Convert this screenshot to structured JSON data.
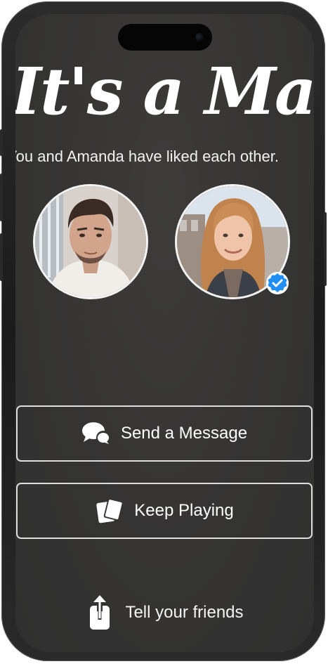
{
  "match": {
    "title": "It's a Match!",
    "subtitle": "You and Amanda have liked each other."
  },
  "avatars": {
    "user": {
      "name": "",
      "verified": false
    },
    "match": {
      "name": "Amanda",
      "verified": true
    }
  },
  "actions": {
    "send_message_label": "Send a Message",
    "keep_playing_label": "Keep Playing",
    "tell_friends_label": "Tell your friends"
  },
  "icons": {
    "send_message": "chat-bubbles-icon",
    "keep_playing": "cards-icon",
    "tell_friends": "share-icon",
    "verified": "verified-badge-icon"
  },
  "colors": {
    "background": "#363534",
    "button_border": "#dedede",
    "text": "#ffffff",
    "verified_badge": "#1f8ef5"
  }
}
